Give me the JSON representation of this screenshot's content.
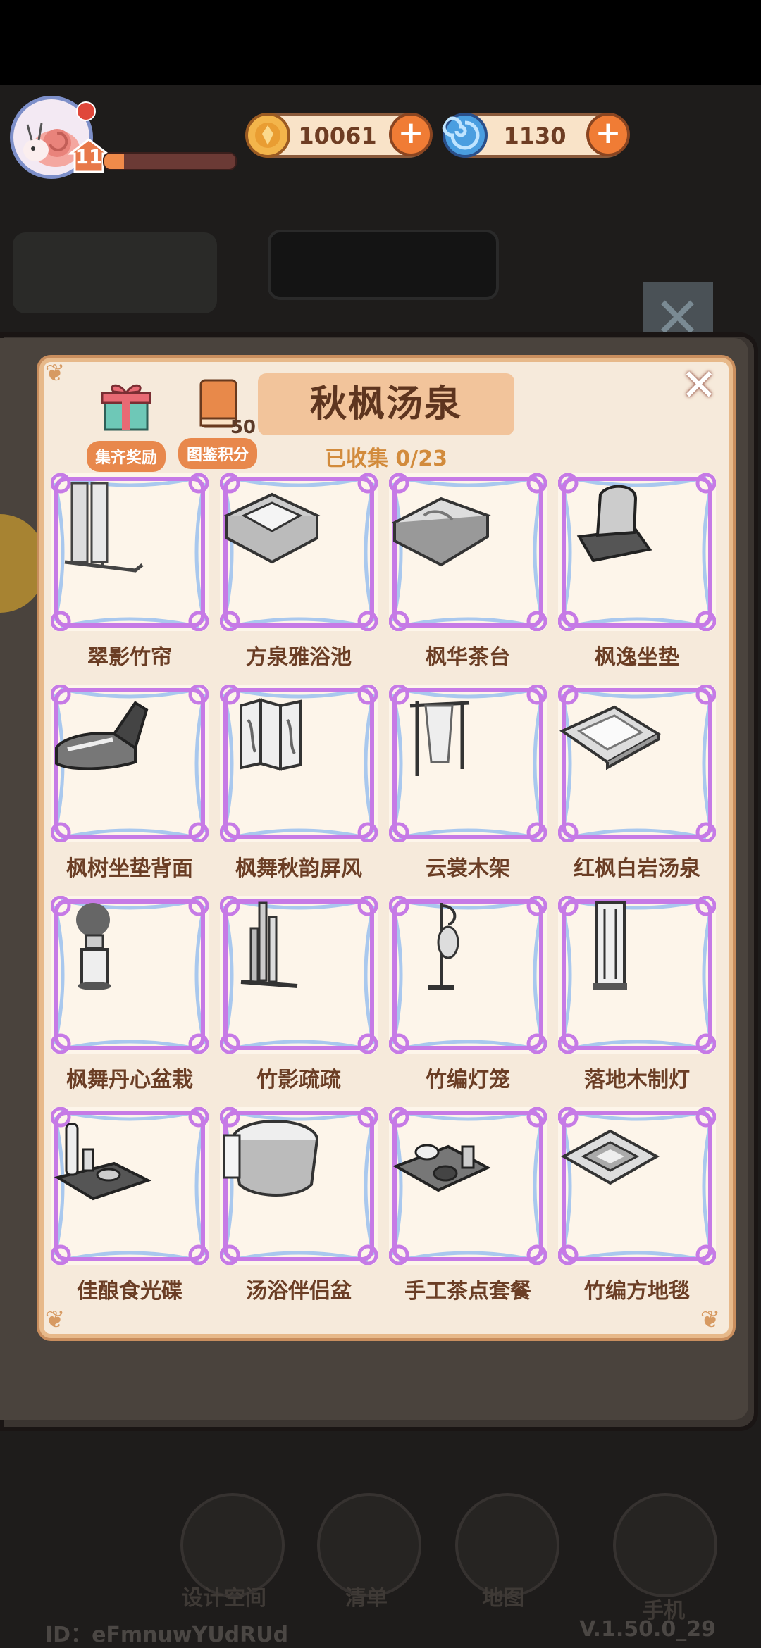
{
  "hud": {
    "level": "11",
    "xp_progress": 0.15,
    "coins": "10061",
    "gems": "1130"
  },
  "panel": {
    "title": "秋枫汤泉",
    "collected": "已收集 0/23",
    "reward_label": "集齐奖励",
    "score_label": "图鉴积分",
    "score_value": "50"
  },
  "items": [
    {
      "name": "翠影竹帘",
      "icon": "bamboo-curtain-icon"
    },
    {
      "name": "方泉雅浴池",
      "icon": "square-bath-icon"
    },
    {
      "name": "枫华茶台",
      "icon": "tea-table-icon"
    },
    {
      "name": "枫逸坐垫",
      "icon": "cushion-icon"
    },
    {
      "name": "枫树坐垫背面",
      "icon": "cushion-back-icon"
    },
    {
      "name": "枫舞秋韵屏风",
      "icon": "folding-screen-icon"
    },
    {
      "name": "云裳木架",
      "icon": "clothes-rack-icon"
    },
    {
      "name": "红枫白岩汤泉",
      "icon": "hot-spring-icon"
    },
    {
      "name": "枫舞丹心盆栽",
      "icon": "bonsai-icon"
    },
    {
      "name": "竹影疏疏",
      "icon": "bamboo-icon"
    },
    {
      "name": "竹编灯笼",
      "icon": "lantern-icon"
    },
    {
      "name": "落地木制灯",
      "icon": "floor-lamp-icon"
    },
    {
      "name": "佳酿食光碟",
      "icon": "sake-tray-icon"
    },
    {
      "name": "汤浴伴侣盆",
      "icon": "bath-tub-icon"
    },
    {
      "name": "手工茶点套餐",
      "icon": "tea-set-icon"
    },
    {
      "name": "竹编方地毯",
      "icon": "rug-icon"
    }
  ],
  "nav": {
    "design": "设计空间",
    "list": "清单",
    "map": "地图",
    "phone": "手机"
  },
  "footer": {
    "id": "ID：eFmnuwYUdRUd",
    "version": "V.1.50.0_29"
  },
  "colors": {
    "panel_bg": "#f6eadb",
    "frame_purple": "#c67ae6",
    "frame_blue": "#a9c8ee",
    "text_brown": "#6b3e25",
    "accent_orange": "#e8884c"
  }
}
